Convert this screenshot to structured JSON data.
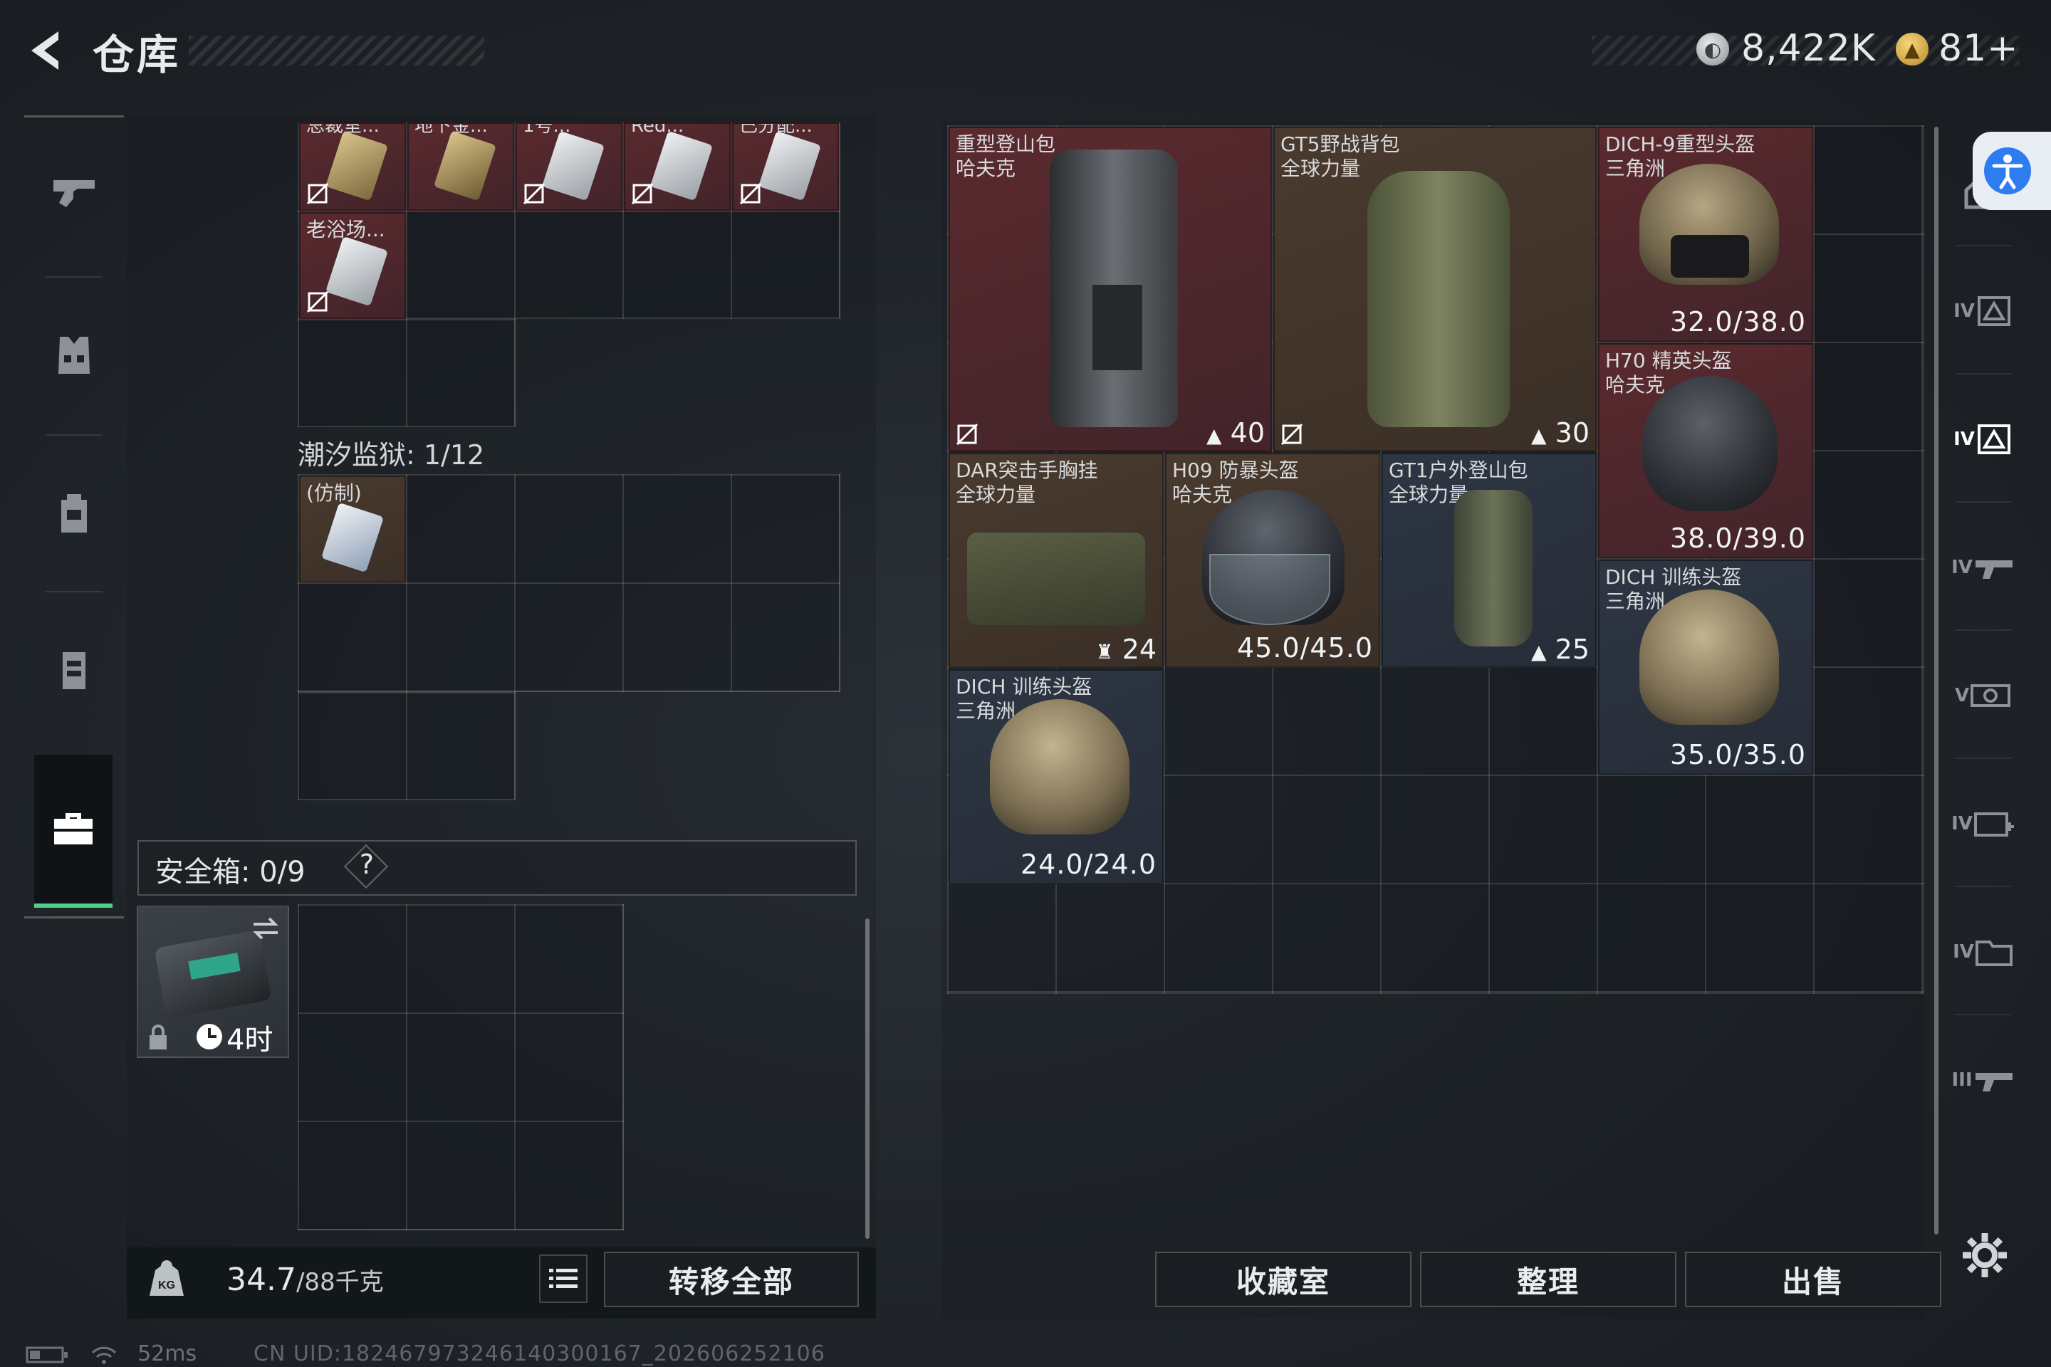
{
  "header": {
    "title": "仓库",
    "currency1": "8,422K",
    "currency2": "81+"
  },
  "nav": [
    "weapons",
    "armor",
    "backpack",
    "chest-rig",
    "safe-box"
  ],
  "left": {
    "top_items": [
      {
        "name": "总裁室..."
      },
      {
        "name": "地下金..."
      },
      {
        "name": "1号..."
      },
      {
        "name": "Red..."
      },
      {
        "name": "已分配..."
      },
      {
        "name": "老浴场..."
      }
    ],
    "tide_label": "潮汐监狱: 1/12",
    "tide_item": "(仿制)",
    "safe_label": "安全箱: 0/9",
    "safe_q": "?",
    "safebox_time": "4时",
    "weight": "34.7",
    "weight_unit": "/88千克",
    "transfer_btn": "转移全部"
  },
  "right": {
    "items": [
      {
        "name": "重型登山包",
        "brand": "哈夫克",
        "count": "40"
      },
      {
        "name": "GT5野战背包",
        "brand": "全球力量",
        "count": "30"
      },
      {
        "name": "DICH-9重型头盔",
        "brand": "三角洲",
        "value": "32.0/38.0"
      },
      {
        "name": "H70 精英头盔",
        "brand": "哈夫克",
        "value": "38.0/39.0"
      },
      {
        "name": "DAR突击手胸挂",
        "brand": "全球力量",
        "count": "24"
      },
      {
        "name": "H09 防暴头盔",
        "brand": "哈夫克",
        "value": "45.0/45.0"
      },
      {
        "name": "GT1户外登山包",
        "brand": "全球力量",
        "count": "25"
      },
      {
        "name": "DICH 训练头盔",
        "brand": "三角洲",
        "value": "35.0/35.0"
      },
      {
        "name": "DICH 训练头盔",
        "brand": "三角洲",
        "value": "24.0/24.0"
      }
    ],
    "collect_btn": "收藏室",
    "sort_btn": "整理",
    "sell_btn": "出售"
  },
  "sidebar_right": [
    "IV",
    "IV",
    "IV",
    "V",
    "IV",
    "IV",
    "III"
  ],
  "status": {
    "ping": "52ms",
    "uid": "CN UID:1824679732461403001​67_202606252106"
  }
}
